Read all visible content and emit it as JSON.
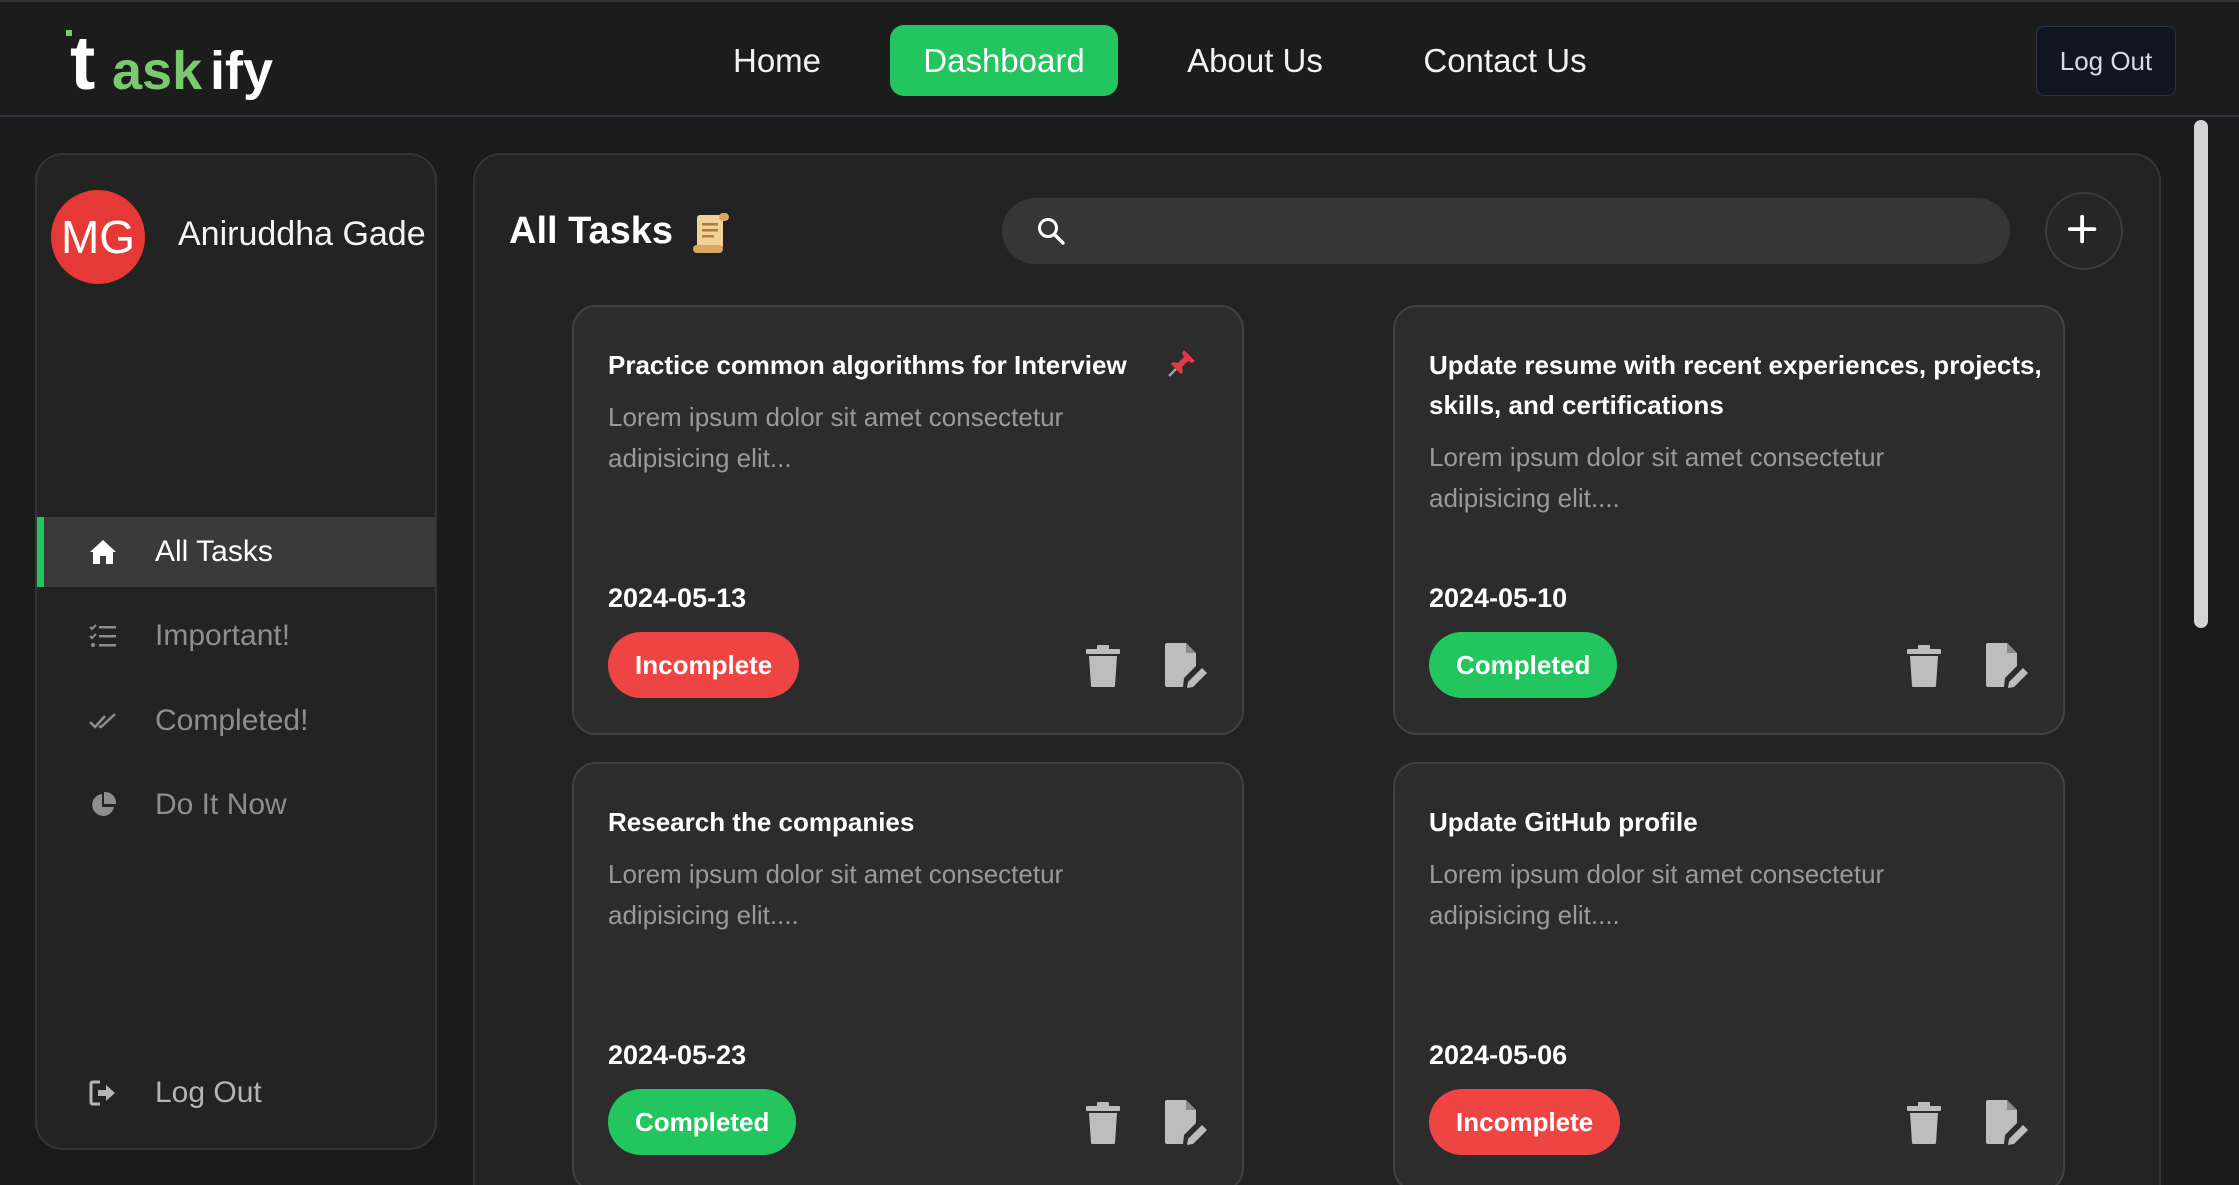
{
  "brand": {
    "logo_letters": [
      "t",
      "ask",
      "ify"
    ],
    "colors": {
      "accent": "#22c55e",
      "danger": "#ef4444",
      "avatar": "#e53935"
    }
  },
  "nav": {
    "links": [
      "Home",
      "Dashboard",
      "About Us",
      "Contact Us"
    ],
    "active": "Dashboard",
    "logout_label": "Log Out"
  },
  "sidebar": {
    "user": {
      "initials": "MG",
      "name": "Aniruddha Gade"
    },
    "items": [
      {
        "label": "All Tasks",
        "icon": "home-icon",
        "active": true
      },
      {
        "label": "Important!",
        "icon": "list-check-icon",
        "active": false
      },
      {
        "label": "Completed!",
        "icon": "double-check-icon",
        "active": false
      },
      {
        "label": "Do It Now",
        "icon": "pie-chart-icon",
        "active": false
      }
    ],
    "logout_label": "Log Out"
  },
  "main": {
    "title": "All Tasks",
    "title_emoji": "scroll-icon",
    "search": {
      "value": "",
      "placeholder": ""
    },
    "add_button": "plus-icon",
    "tasks": [
      {
        "title": "Practice common algorithms for Interview",
        "description": "Lorem ipsum dolor sit amet consectetur adipisicing elit...",
        "date": "2024-05-13",
        "status": "Incomplete",
        "pinned": true
      },
      {
        "title": "Update resume with recent experiences, projects, skills, and certifications",
        "description": "Lorem ipsum dolor sit amet consectetur adipisicing elit....",
        "date": "2024-05-10",
        "status": "Completed",
        "pinned": false
      },
      {
        "title": "Research the companies",
        "description": "Lorem ipsum dolor sit amet consectetur adipisicing elit....",
        "date": "2024-05-23",
        "status": "Completed",
        "pinned": false
      },
      {
        "title": "Update GitHub profile",
        "description": "Lorem ipsum dolor sit amet consectetur adipisicing elit....",
        "date": "2024-05-06",
        "status": "Incomplete",
        "pinned": false
      }
    ]
  }
}
